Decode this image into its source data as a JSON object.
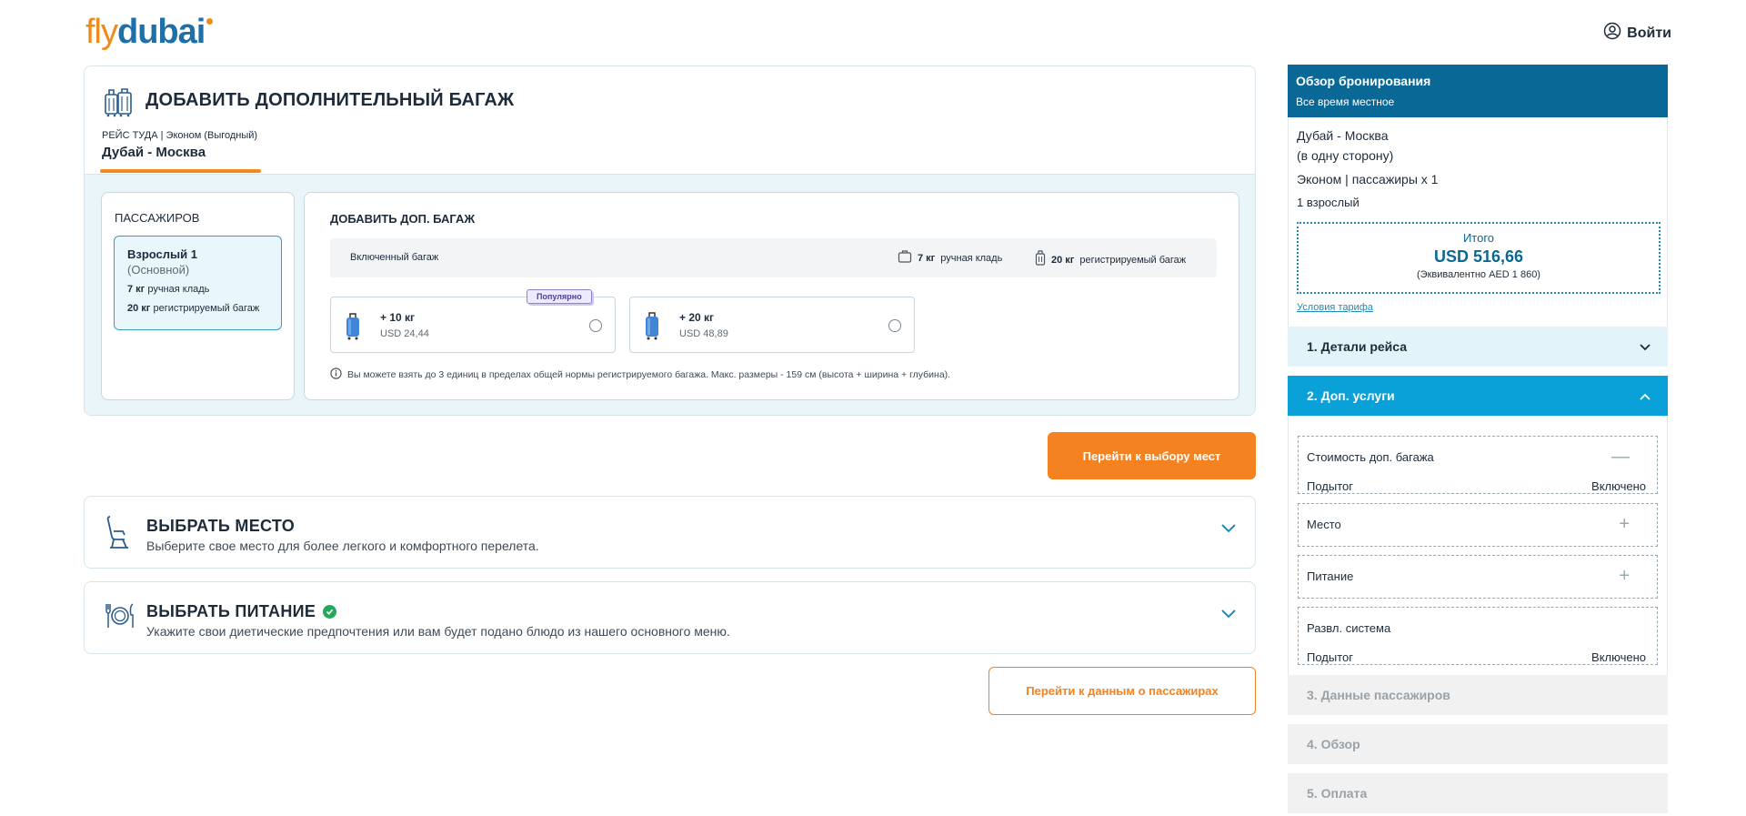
{
  "header": {
    "logo_fly": "fly",
    "logo_dubai": "dubai",
    "login_label": "Войти"
  },
  "baggage": {
    "title": "ДОБАВИТЬ ДОПОЛНИТЕЛЬНЫЙ БАГАЖ",
    "flight_type": "РЕЙС ТУДА | Эконом (Выгодный)",
    "route": "Дубай - Москва",
    "passengers": {
      "title": "ПАССАЖИРОВ",
      "name": "Взрослый 1",
      "role": "(Основной)",
      "cabin_weight": "7 кг",
      "cabin_label": "ручная кладь",
      "checked_weight": "20 кг",
      "checked_label": "регистрируемый багаж"
    },
    "add": {
      "title": "ДОБАВИТЬ ДОП. БАГАЖ",
      "included_label": "Включенный багаж",
      "included_cabin_weight": "7 кг",
      "included_cabin_label": "ручная кладь",
      "included_checked_weight": "20 кг",
      "included_checked_label": "регистрируемый багаж",
      "popular_badge": "Популярно",
      "options": [
        {
          "weight": "+ 10 кг",
          "price": "USD 24,44"
        },
        {
          "weight": "+ 20 кг",
          "price": "USD 48,89"
        }
      ],
      "note": "Вы можете взять до 3 единиц в пределах общей нормы регистрируемого багажа. Макс. размеры - 159 см (высота + ширина + глубина)."
    }
  },
  "buttons": {
    "seats": "Перейти к выбору мест",
    "passengers": "Перейти к данным о пассажирах"
  },
  "seat_section": {
    "title": "ВЫБРАТЬ МЕСТО",
    "description": "Выберите свое место для более легкого и комфортного перелета."
  },
  "meal_section": {
    "title": "ВЫБРАТЬ ПИТАНИЕ",
    "description": "Укажите свои диетические предпочтения или вам будет подано блюдо из нашего основного меню."
  },
  "sidebar": {
    "title": "Обзор бронирования",
    "subtitle": "Все время местное",
    "route": "Дубай - Москва",
    "trip_type": "(в одну сторону)",
    "class_pax": "Эконом | пассажиры x 1",
    "adults": "1 взрослый",
    "total_label": "Итого",
    "total_usd": "USD 516,66",
    "total_aed": "(Эквивалентно AED 1 860)",
    "terms_link": "Условия тарифа",
    "steps": [
      {
        "label": "1. Детали рейса"
      },
      {
        "label": "2. Доп. услуги"
      },
      {
        "label": "3. Данные пассажиров"
      },
      {
        "label": "4. Обзор"
      },
      {
        "label": "5. Оплата"
      }
    ],
    "services": {
      "baggage_label": "Стоимость доп. багажа",
      "baggage_action": "—",
      "baggage_subtotal_label": "Подытог",
      "baggage_subtotal_value": "Включено",
      "seat_label": "Место",
      "seat_action": "+",
      "meal_label": "Питание",
      "meal_action": "+",
      "ife_label": "Развл. система",
      "ife_subtotal_label": "Подытог",
      "ife_subtotal_value": "Включено"
    }
  },
  "colors": {
    "brand_orange": "#f58220",
    "brand_blue": "#0a6896",
    "active_step": "#0aa0d8"
  }
}
